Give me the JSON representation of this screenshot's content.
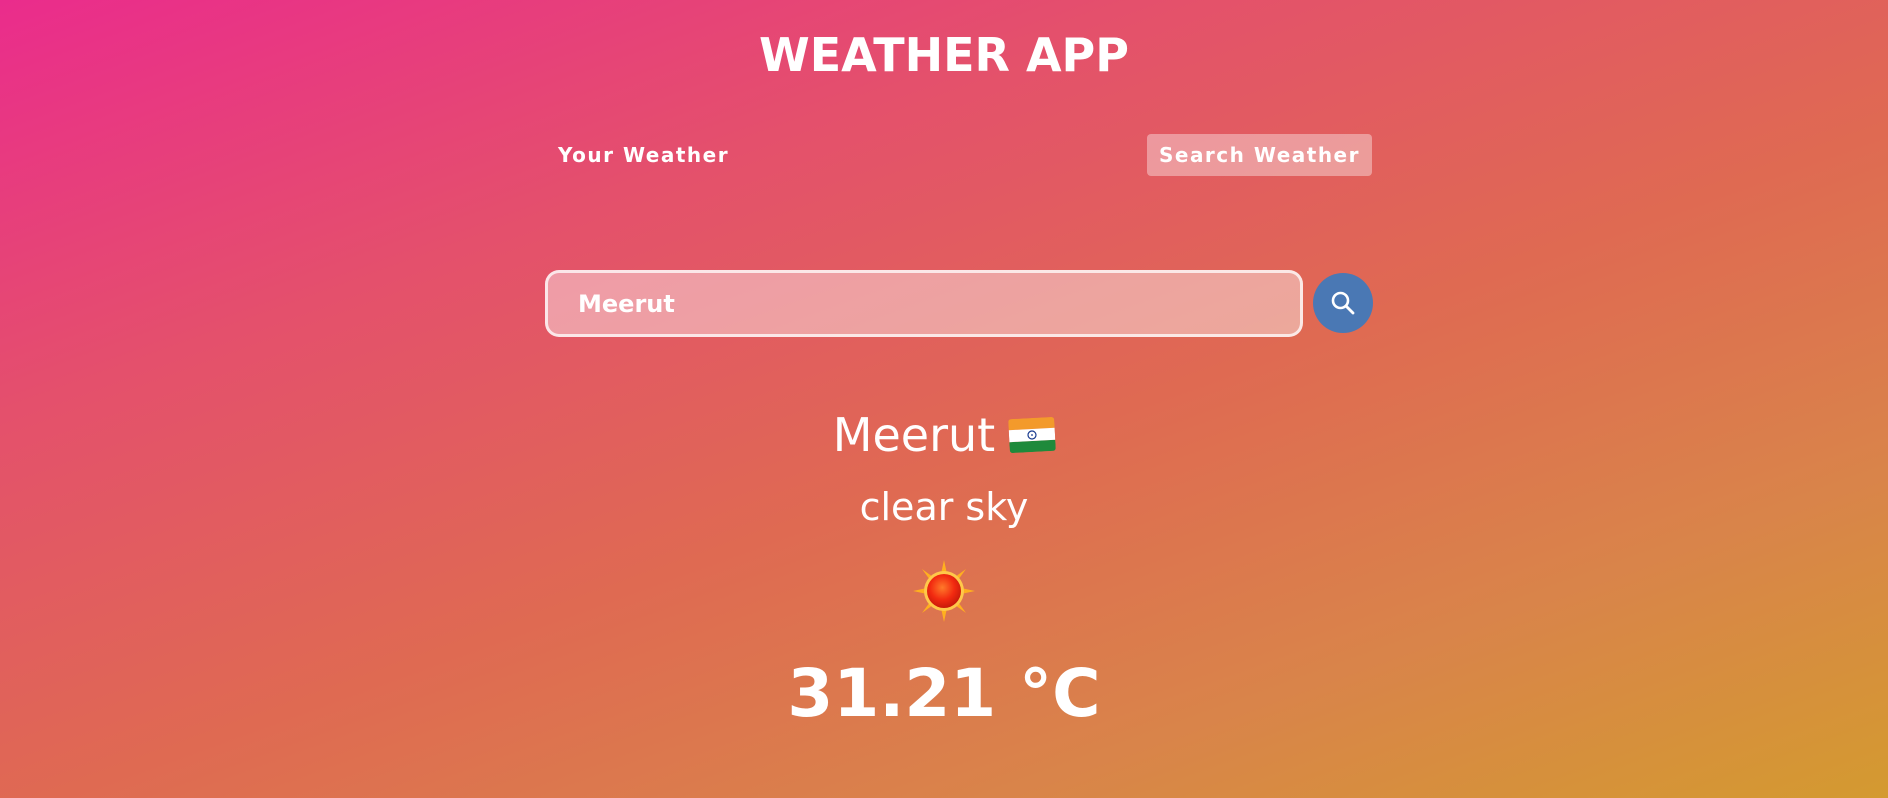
{
  "app": {
    "title": "WEATHER APP"
  },
  "tabs": [
    {
      "label": "Your Weather",
      "active": false
    },
    {
      "label": "Search Weather",
      "active": true
    }
  ],
  "search": {
    "value": "Meerut",
    "button_icon": "search-icon"
  },
  "weather": {
    "city": "Meerut",
    "country_flag_icon": "india-flag-icon",
    "description": "clear sky",
    "condition_icon": "sun-icon",
    "temperature": "31.21 °C"
  },
  "colors": {
    "gradient_start": "#ea2c8c",
    "gradient_end": "#d49a30",
    "search_button": "#4a78b4",
    "text": "#ffffff"
  }
}
